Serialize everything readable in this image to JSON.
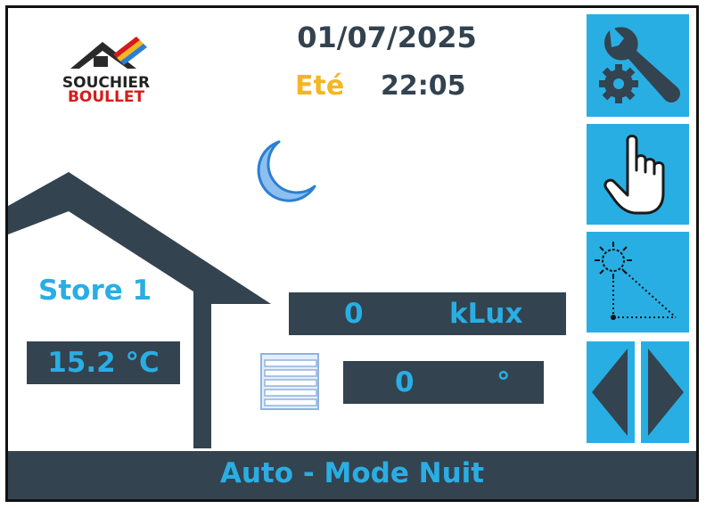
{
  "brand": {
    "line1": "SOUCHIER",
    "line2": "BOULLET"
  },
  "header": {
    "date": "01/07/2025",
    "season": "Eté",
    "time": "22:05"
  },
  "weather": {
    "icon": "moon-icon"
  },
  "zone": {
    "name": "Store 1",
    "temperature": "15.2 °C"
  },
  "sensors": {
    "lux_value": "0",
    "lux_unit": "kLux",
    "angle_value": "0",
    "angle_unit": "°"
  },
  "side_buttons": [
    {
      "icon": "settings-wrench-gear-icon"
    },
    {
      "icon": "hand-pointer-icon"
    },
    {
      "icon": "sun-angle-icon"
    },
    {
      "icon": "arrow-left-icon"
    },
    {
      "icon": "arrow-right-icon"
    }
  ],
  "status": {
    "mode": "Auto - Mode Nuit"
  },
  "colors": {
    "accent": "#29aee4",
    "panel": "#33434f",
    "season": "#f5b622",
    "brand_red": "#d41c1c"
  }
}
